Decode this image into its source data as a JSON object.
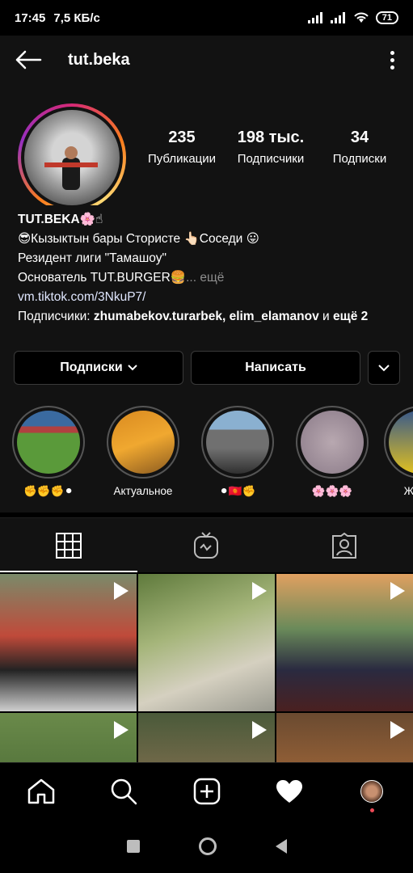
{
  "status_bar": {
    "time": "17:45",
    "speed": "7,5 КБ/с",
    "battery": "71"
  },
  "header": {
    "username": "tut.beka",
    "back_icon": "arrow-left-icon",
    "menu_icon": "more-vertical-icon"
  },
  "profile": {
    "stats": [
      {
        "value": "235",
        "label": "Публикации"
      },
      {
        "value": "198 тыс.",
        "label": "Подписчики"
      },
      {
        "value": "34",
        "label": "Подписки"
      }
    ]
  },
  "bio": {
    "name": "TUT.BEKA🌸☝",
    "line1": "😎Кызыктын бары Стористе 👆🏻Соседи 😛",
    "line2": "Резидент лиги \"Тамашоу\"",
    "line3": "Основатель TUT.BURGER🍔",
    "more": "... ещё",
    "link": "vm.tiktok.com/3NkuP7/",
    "followers_prefix": "Подписчики: ",
    "followers_names": "zhumabekov.turarbek, elim_elamanov",
    "followers_and": " и ",
    "followers_more": "ещё 2"
  },
  "actions": {
    "following_label": "Подписки",
    "message_label": "Написать"
  },
  "highlights": [
    {
      "label": "✊✊✊⚫"
    },
    {
      "label": "Актуальное"
    },
    {
      "label": "⚫🇰🇬✊"
    },
    {
      "label": "🌸🌸🌸"
    },
    {
      "label": "Жизнь"
    }
  ],
  "tabs": [
    "grid-icon",
    "igtv-icon",
    "tagged-icon"
  ],
  "bottom_nav": [
    "home-icon",
    "search-icon",
    "add-icon",
    "heart-icon",
    "profile-avatar"
  ],
  "colors": {
    "background": "#121212",
    "text": "#ffffff",
    "muted": "#8e8e8e",
    "notification": "#ed4956"
  }
}
